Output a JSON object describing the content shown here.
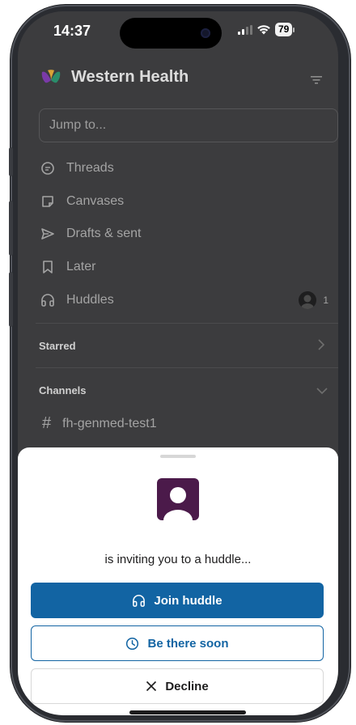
{
  "status_bar": {
    "time": "14:37",
    "battery": "79"
  },
  "workspace": {
    "name": "Western Health"
  },
  "search": {
    "placeholder": "Jump to..."
  },
  "nav": [
    {
      "label": "Threads",
      "icon": "threads-icon"
    },
    {
      "label": "Canvases",
      "icon": "canvas-icon"
    },
    {
      "label": "Drafts & sent",
      "icon": "send-icon"
    },
    {
      "label": "Later",
      "icon": "bookmark-icon"
    },
    {
      "label": "Huddles",
      "icon": "headphones-icon"
    }
  ],
  "huddles_count": "1",
  "sections": {
    "starred": "Starred",
    "channels": "Channels"
  },
  "channels": [
    {
      "name": "fh-genmed-test1"
    }
  ],
  "sheet": {
    "invite_text": "is inviting you to a huddle...",
    "join_label": "Join huddle",
    "soon_label": "Be there soon",
    "decline_label": "Decline"
  },
  "colors": {
    "accent": "#1264a3",
    "avatar": "#4b1a4a"
  }
}
